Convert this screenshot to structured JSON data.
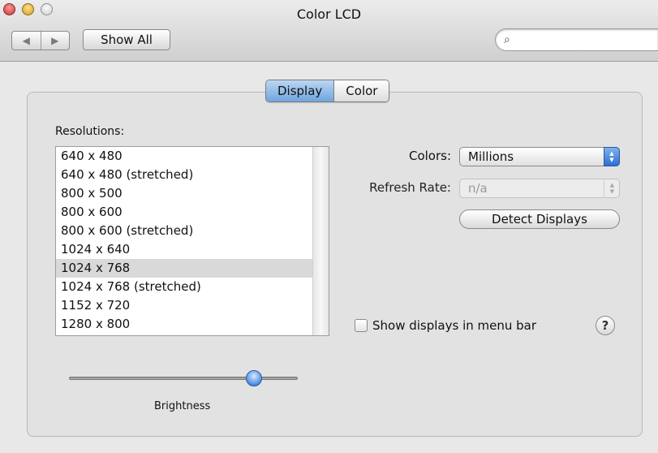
{
  "window": {
    "title": "Color LCD"
  },
  "toolbar": {
    "back_icon": "back-arrow-icon",
    "forward_icon": "forward-arrow-icon",
    "show_all_label": "Show All",
    "search": {
      "value": "",
      "placeholder": "",
      "icon": "magnifier-icon"
    }
  },
  "tabs": [
    {
      "label": "Display",
      "selected": true
    },
    {
      "label": "Color",
      "selected": false
    }
  ],
  "resolutions": {
    "label": "Resolutions:",
    "items": [
      "640 x 480",
      "640 x 480 (stretched)",
      "800 x 500",
      "800 x 600",
      "800 x 600 (stretched)",
      "1024 x 640",
      "1024 x 768",
      "1024 x 768 (stretched)",
      "1152 x 720",
      "1280 x 800"
    ],
    "selected": "1024 x 768"
  },
  "colors": {
    "label": "Colors:",
    "value": "Millions"
  },
  "refresh_rate": {
    "label": "Refresh Rate:",
    "value": "n/a",
    "enabled": false
  },
  "detect_displays_label": "Detect Displays",
  "show_in_menu_bar": {
    "label": "Show displays in menu bar",
    "checked": false
  },
  "help_label": "?",
  "brightness": {
    "label": "Brightness",
    "level": 0.81
  },
  "colors_palette": {
    "accent": "#4a8de0",
    "selected_row": "#d9d9d9"
  }
}
